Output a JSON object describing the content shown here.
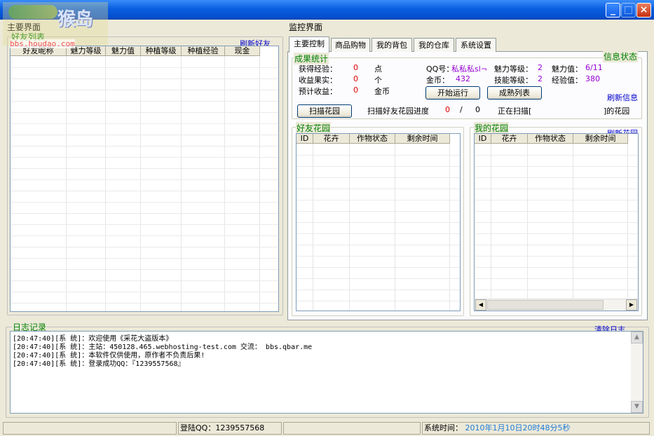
{
  "window": {
    "title": "",
    "btn_min": "_",
    "btn_max": "□",
    "btn_close": "×"
  },
  "watermark": {
    "text": "猴岛",
    "site": "bbs.houdao.com"
  },
  "left": {
    "section_title": "主要界面",
    "friend_list_title": "好友列表",
    "refresh_friends": "刷新好友",
    "columns": [
      "好友昵称",
      "魅力等级",
      "魅力值",
      "种植等级",
      "种植经验",
      "现金"
    ]
  },
  "right": {
    "section_title": "监控界面",
    "tabs": [
      "主要控制",
      "商品购物",
      "我的背包",
      "我的仓库",
      "系统设置"
    ],
    "stats_group": "成果统计",
    "info_group": "信息状态",
    "stats": [
      {
        "label": "获得经验：",
        "value": "0",
        "unit": "点"
      },
      {
        "label": "收益果实：",
        "value": "0",
        "unit": "个"
      },
      {
        "label": "预计收益：",
        "value": "0",
        "unit": "金币"
      }
    ],
    "info": {
      "qq_label": "QQ号：",
      "qq_value": "私私私sl¬",
      "charm_level_label": "魅力等级：",
      "charm_level_value": "2",
      "charm_label": "魅力值：",
      "charm_value": "6/11",
      "gold_label": "金币：",
      "gold_value": "432",
      "skill_level_label": "技能等级：",
      "skill_level_value": "2",
      "exp_label": "经验值：",
      "exp_value": "380"
    },
    "start_button": "开始运行",
    "mature_button": "成熟列表",
    "refresh_info": "刷新信息",
    "scan_button": "扫描花园",
    "scan_progress_label": "扫描好友花园进度",
    "scan_current": "0",
    "scan_sep": "/",
    "scan_total": "0",
    "scanning_label": "正在扫描[",
    "scanning_suffix": "]的花园",
    "friend_garden": {
      "title": "好友花园",
      "columns": [
        "ID",
        "花卉",
        "作物状态",
        "剩余时间"
      ]
    },
    "my_garden": {
      "title": "我的花园",
      "refresh": "刷新花园",
      "columns": [
        "ID",
        "花卉",
        "作物状态",
        "剩余时间"
      ]
    }
  },
  "log": {
    "title": "日志记录",
    "clear": "清除日志",
    "lines": [
      "[20:47:40][系  统]：欢迎使用《采花大盗版本》",
      "[20:47:40][系  统]：主站：450128.465.webhosting-test.com 交流： bbs.qbar.me",
      "[20:47:40][系  统]：本软件仅供使用，原作者不负责后果!",
      "[20:47:40][系  统]：登录成功QQ：『1239557568』"
    ]
  },
  "statusbar": {
    "login": "登陆QQ：1239557568",
    "time_label": "系统时间：",
    "time_value": "2010年1月10日20时48分5秒"
  },
  "colors": {
    "titlebar": "#0a5fe0",
    "value_red": "#e00000",
    "value_purple": "#9400d3",
    "group_label": "#008000",
    "link": "#0000cc",
    "time": "#1e7bd8"
  }
}
